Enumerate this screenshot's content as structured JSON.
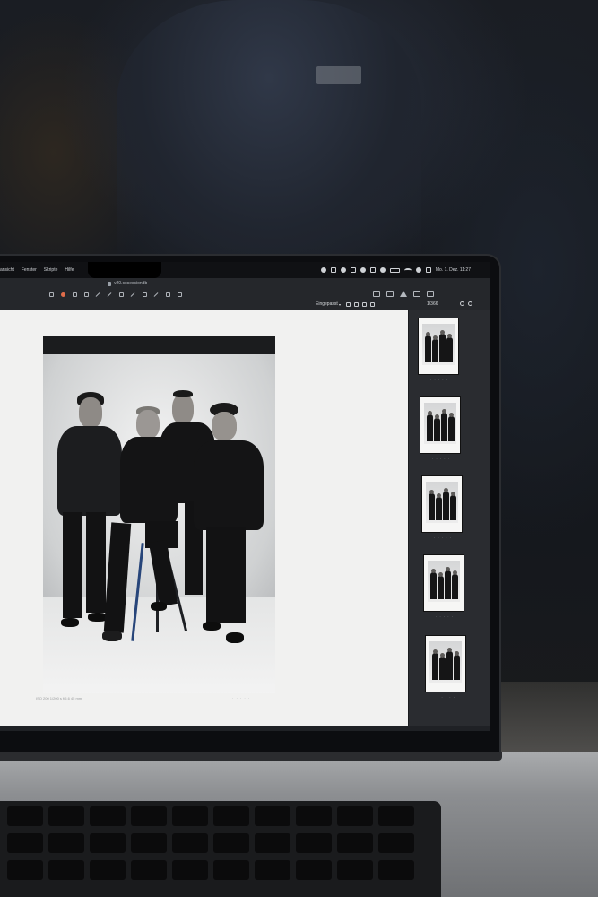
{
  "menubar": {
    "items": [
      "ansicht",
      "Fenster",
      "Skripte",
      "Hilfe"
    ],
    "clock": "Mo. 1. Dez.  11:27"
  },
  "toolbar": {
    "document_title": "v20.cosessiondb"
  },
  "viewer_strip": {
    "fit_label": "Eingepasst",
    "image_counter": "1/366"
  },
  "photo": {
    "meta": "ISO 200     1/200 s     f/5.6     45 mm",
    "rating": "· · · · ·"
  },
  "filmstrip": {
    "thumbnails": [
      {
        "caption": "· · · · ·"
      },
      {
        "caption": "· · · · ·"
      },
      {
        "caption": "· · · · ·"
      },
      {
        "caption": "· · · · ·"
      },
      {
        "caption": "· · · · ·"
      }
    ]
  },
  "colors": {
    "accent_red": "#e06c4a",
    "viewer_bg": "#f1f1f0",
    "panel_bg": "#2a2c30"
  }
}
